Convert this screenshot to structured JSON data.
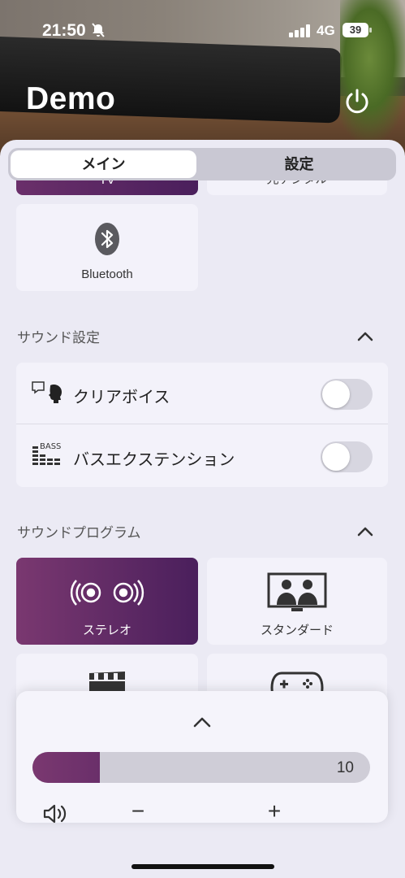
{
  "status_bar": {
    "time": "21:50",
    "network": "4G",
    "battery": "39"
  },
  "header": {
    "title": "Demo"
  },
  "tabs": [
    {
      "label": "メイン",
      "selected": true
    },
    {
      "label": "設定",
      "selected": false
    }
  ],
  "inputs_partial": {
    "left_label": "TV",
    "right_label": "光デジタル"
  },
  "bluetooth": {
    "label": "Bluetooth"
  },
  "sound_settings": {
    "title": "サウンド設定",
    "items": [
      {
        "label": "クリアボイス",
        "enabled": false
      },
      {
        "label": "バスエクステンション",
        "enabled": false
      }
    ],
    "bass_icon_text": "BASS"
  },
  "sound_program": {
    "title": "サウンドプログラム",
    "items": [
      {
        "label": "ステレオ",
        "selected": true
      },
      {
        "label": "スタンダード",
        "selected": false
      }
    ]
  },
  "volume": {
    "value": "10",
    "fill_fraction": 0.2
  },
  "colors": {
    "accent": "#6a2f6a",
    "sheet": "#ebeaf4",
    "card": "#f3f2fa"
  }
}
